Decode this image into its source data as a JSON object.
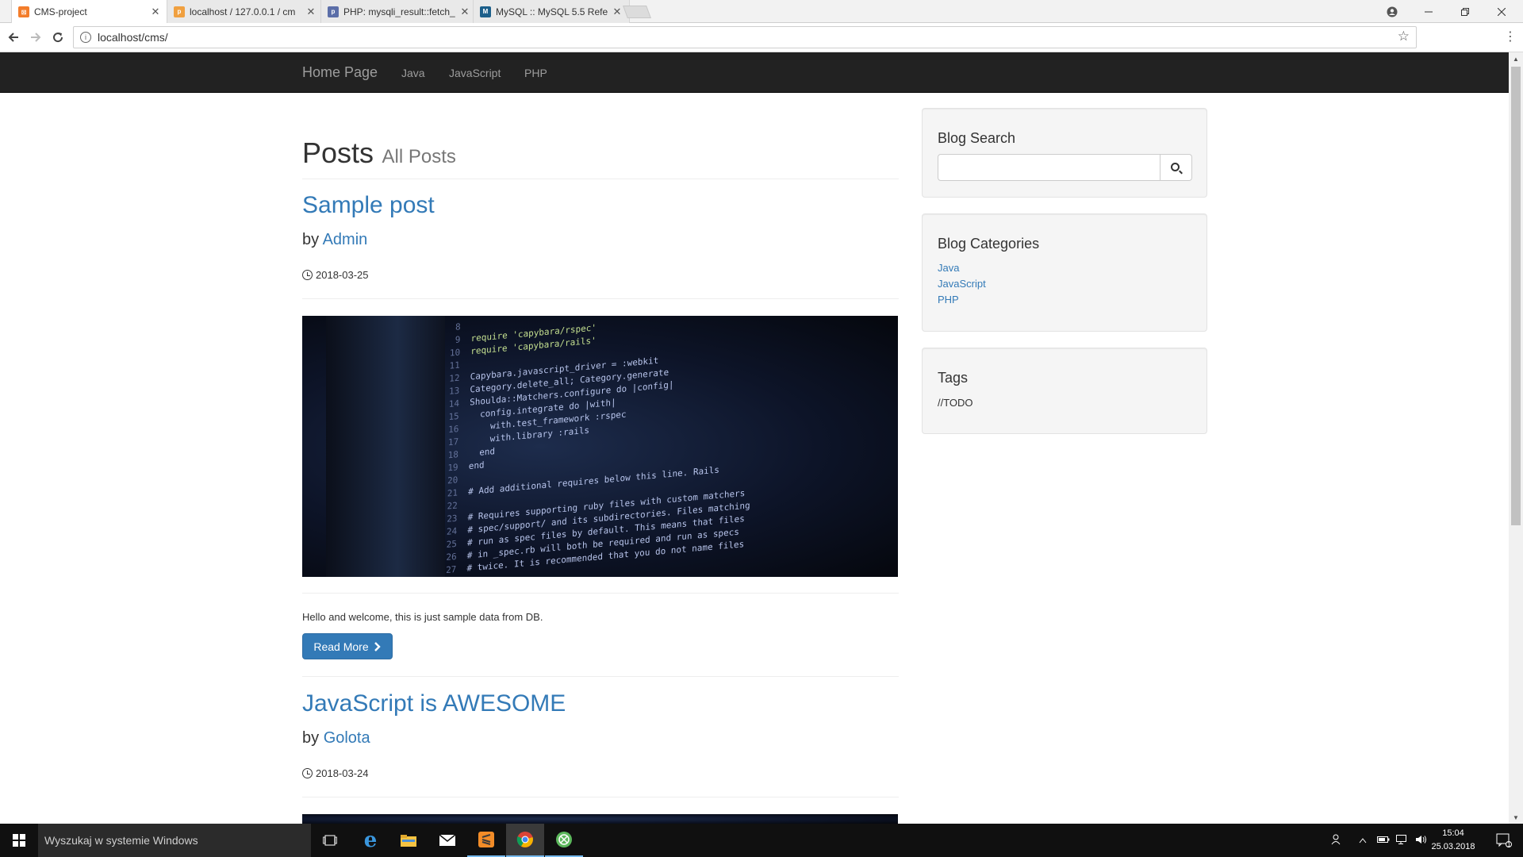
{
  "browser": {
    "tabs": [
      {
        "title": "CMS-project",
        "favicon": "xampp-icon",
        "active": true
      },
      {
        "title": "localhost / 127.0.0.1 / cm",
        "favicon": "phpmyadmin-icon",
        "active": false
      },
      {
        "title": "PHP: mysqli_result::fetch_",
        "favicon": "php-icon",
        "active": false
      },
      {
        "title": "MySQL :: MySQL 5.5 Refe",
        "favicon": "mysql-icon",
        "active": false
      }
    ],
    "tab_close": "✕",
    "url": "localhost/cms/",
    "colors": {
      "tab_active": "#ffffff",
      "tab_inactive": "#e9e9e9"
    }
  },
  "site": {
    "brand": "Home Page",
    "nav": [
      "Java",
      "JavaScript",
      "PHP"
    ],
    "page_title": "Posts",
    "page_subtitle": "All Posts",
    "colors": {
      "navbar": "#222222",
      "link": "#337ab7"
    }
  },
  "posts": [
    {
      "title": "Sample post",
      "by_prefix": "by",
      "author": "Admin",
      "date": "2018-03-25",
      "excerpt": "Hello and welcome, this is just sample data from DB.",
      "read_more": "Read More"
    },
    {
      "title": "JavaScript is AWESOME",
      "by_prefix": "by",
      "author": "Golota",
      "date": "2018-03-24"
    }
  ],
  "code_image": {
    "lines": [
      {
        "n": "8",
        "t": ""
      },
      {
        "n": "9",
        "t": "require 'capybara/rspec'"
      },
      {
        "n": "10",
        "t": "require 'capybara/rails'"
      },
      {
        "n": "11",
        "t": ""
      },
      {
        "n": "12",
        "t": "Capybara.javascript_driver = :webkit"
      },
      {
        "n": "13",
        "t": "Category.delete_all; Category.generate"
      },
      {
        "n": "14",
        "t": "Shoulda::Matchers.configure do |config|"
      },
      {
        "n": "15",
        "t": "  config.integrate do |with|"
      },
      {
        "n": "16",
        "t": "    with.test_framework :rspec"
      },
      {
        "n": "17",
        "t": "    with.library :rails"
      },
      {
        "n": "18",
        "t": "  end"
      },
      {
        "n": "19",
        "t": "end"
      },
      {
        "n": "20",
        "t": ""
      },
      {
        "n": "21",
        "t": "# Add additional requires below this line. Rails"
      },
      {
        "n": "22",
        "t": ""
      },
      {
        "n": "23",
        "t": "# Requires supporting ruby files with custom matchers"
      },
      {
        "n": "24",
        "t": "# spec/support/ and its subdirectories. Files matching"
      },
      {
        "n": "25",
        "t": "# run as spec files by default. This means that files"
      },
      {
        "n": "26",
        "t": "# in _spec.rb will both be required and run as specs"
      },
      {
        "n": "27",
        "t": "# twice. It is recommended that you do not name files"
      }
    ]
  },
  "sidebar": {
    "search": {
      "title": "Blog Search",
      "placeholder": "",
      "button_icon": "search-icon"
    },
    "categories": {
      "title": "Blog Categories",
      "items": [
        "Java",
        "JavaScript",
        "PHP"
      ]
    },
    "tags": {
      "title": "Tags",
      "text": "//TODO"
    }
  },
  "taskbar": {
    "search_placeholder": "Wyszukaj w systemie Windows",
    "time": "15:04",
    "date": "25.03.2018",
    "notification_count": "1"
  }
}
